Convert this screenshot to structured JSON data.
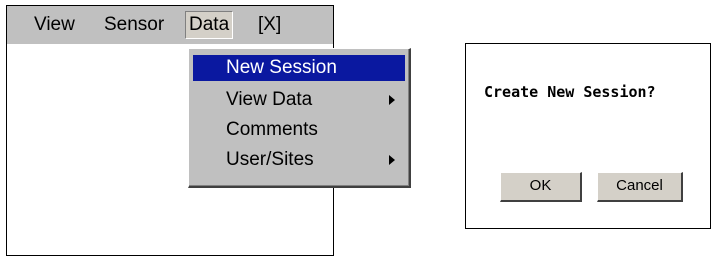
{
  "menubar": {
    "items": [
      {
        "label": "View"
      },
      {
        "label": "Sensor"
      },
      {
        "label": "Data"
      },
      {
        "label": "[X]"
      }
    ]
  },
  "data_menu": {
    "items": [
      {
        "label": "New Session",
        "selected": true,
        "has_submenu": false
      },
      {
        "label": "View Data",
        "has_submenu": true
      },
      {
        "label": "Comments",
        "has_submenu": false
      },
      {
        "label": "User/Sites",
        "has_submenu": true
      }
    ]
  },
  "dialog": {
    "message": "Create New Session?",
    "ok_label": "OK",
    "cancel_label": "Cancel"
  },
  "colors": {
    "menubar": "#c0c0c0",
    "selection": "#0a18a0"
  }
}
